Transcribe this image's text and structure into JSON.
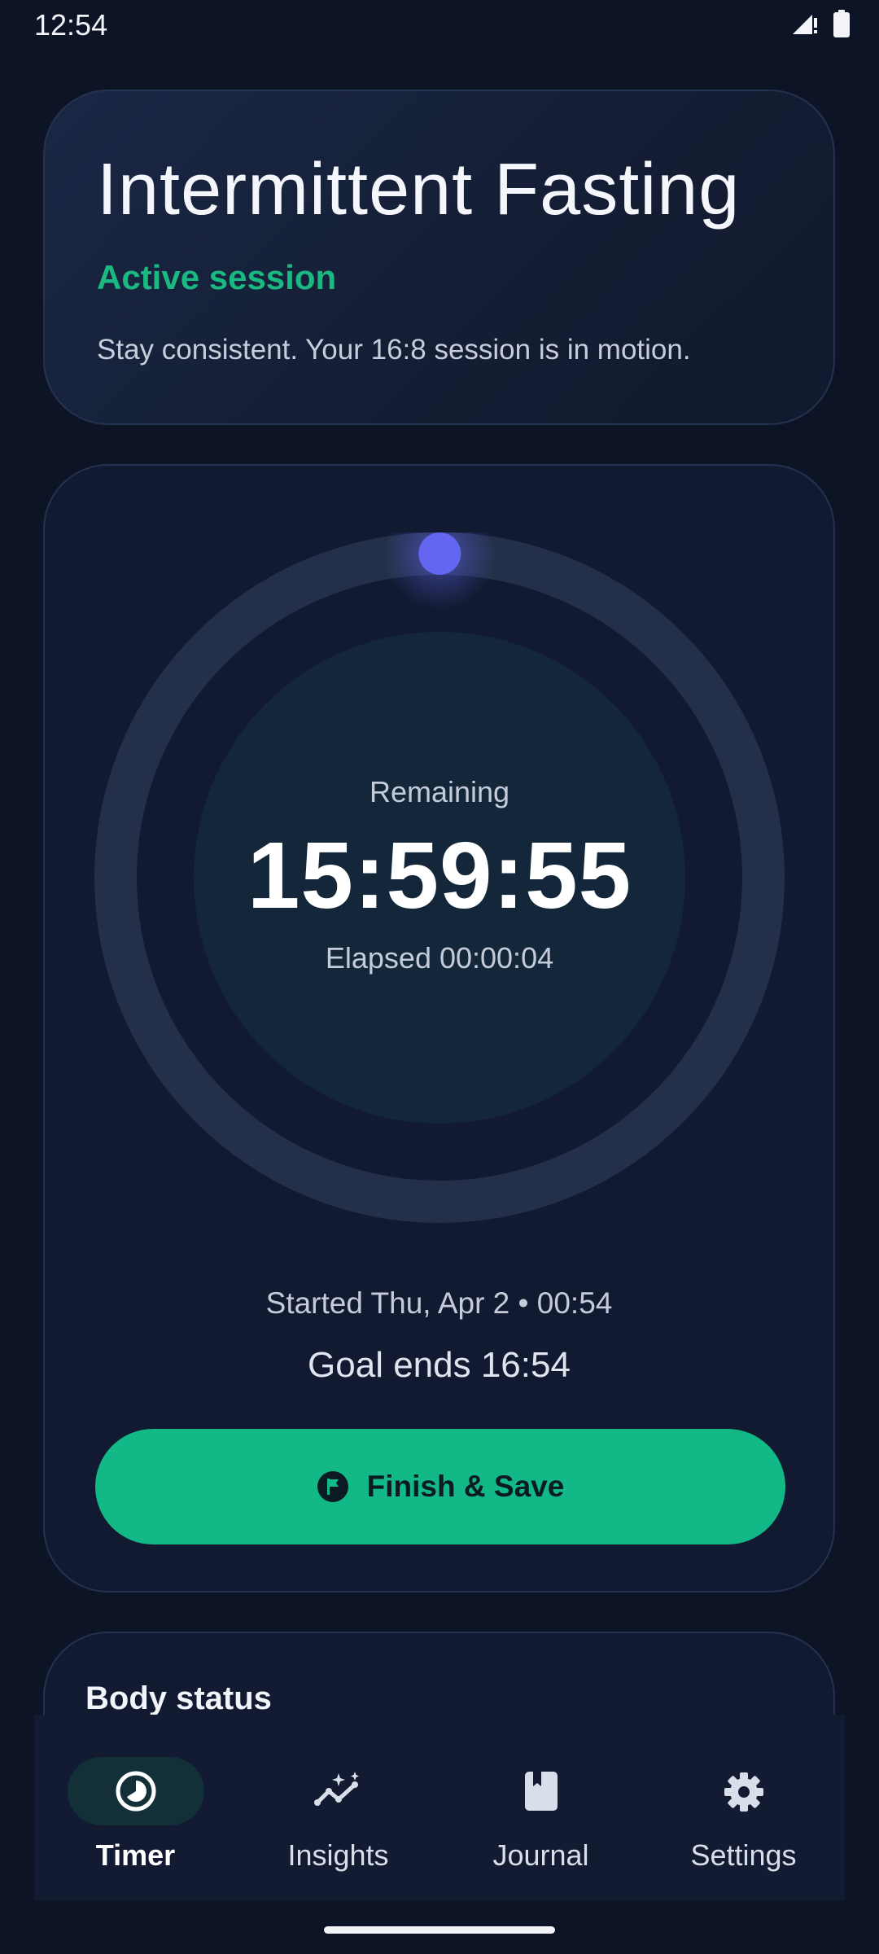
{
  "status_bar": {
    "time": "12:54"
  },
  "header": {
    "title": "Intermittent Fasting",
    "status": "Active session",
    "description": "Stay consistent. Your 16:8 session is in motion."
  },
  "timer": {
    "remaining_label": "Remaining",
    "remaining_value": "15:59:55",
    "elapsed": "Elapsed 00:00:04",
    "progress_fraction": 0.0001,
    "started": "Started Thu, Apr 2 • 00:54",
    "goal_ends": "Goal ends 16:54",
    "finish_label": "Finish & Save"
  },
  "body_status": {
    "title": "Body status"
  },
  "nav": {
    "items": [
      {
        "label": "Timer",
        "icon": "timer-icon",
        "active": true
      },
      {
        "label": "Insights",
        "icon": "insights-icon",
        "active": false
      },
      {
        "label": "Journal",
        "icon": "journal-icon",
        "active": false
      },
      {
        "label": "Settings",
        "icon": "gear-icon",
        "active": false
      }
    ]
  },
  "colors": {
    "background": "#0d1426",
    "accent_green": "#12b886",
    "progress_knob": "#6366f1",
    "ring_track": "#243049"
  }
}
